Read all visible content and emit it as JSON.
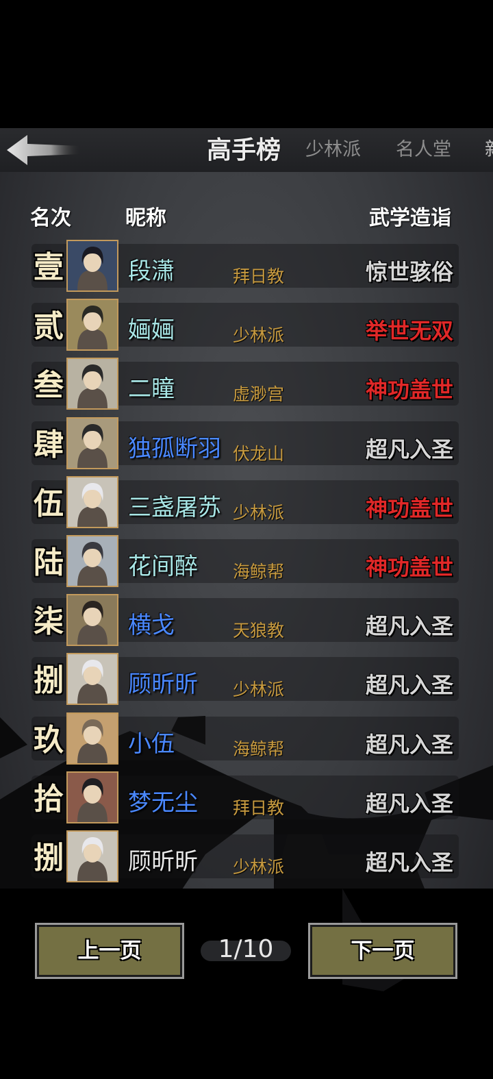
{
  "header": {
    "tabs": [
      {
        "label": "高手榜",
        "active": true
      },
      {
        "label": "少林派",
        "active": false
      },
      {
        "label": "名人堂",
        "active": false
      }
    ]
  },
  "columns": {
    "rank": "名次",
    "nickname": "昵称",
    "skill": "武学造诣"
  },
  "rows": [
    {
      "rank": "壹",
      "name": "段潇",
      "sect": "拜日教",
      "level": "惊世骇俗",
      "name_color": "#a8e6e6",
      "level_color": "#d7d7d7"
    },
    {
      "rank": "贰",
      "name": "婳婳",
      "sect": "少林派",
      "level": "举世无双",
      "name_color": "#a8e6e6",
      "level_color": "#e02828"
    },
    {
      "rank": "叁",
      "name": "二瞳",
      "sect": "虚渺宫",
      "level": "神功盖世",
      "name_color": "#a8e6e6",
      "level_color": "#e02828"
    },
    {
      "rank": "肆",
      "name": "独孤断羽",
      "sect": "伏龙山",
      "level": "超凡入圣",
      "name_color": "#4a88ff",
      "level_color": "#d7d7d7"
    },
    {
      "rank": "伍",
      "name": "三盏屠苏",
      "sect": "少林派",
      "level": "神功盖世",
      "name_color": "#a8e6e6",
      "level_color": "#e02828"
    },
    {
      "rank": "陆",
      "name": "花间醉",
      "sect": "海鲸帮",
      "level": "神功盖世",
      "name_color": "#a8e6e6",
      "level_color": "#e02828"
    },
    {
      "rank": "柒",
      "name": "横戈",
      "sect": "天狼教",
      "level": "超凡入圣",
      "name_color": "#4a88ff",
      "level_color": "#d7d7d7"
    },
    {
      "rank": "捌",
      "name": "顾昕昕",
      "sect": "少林派",
      "level": "超凡入圣",
      "name_color": "#4a88ff",
      "level_color": "#d7d7d7"
    },
    {
      "rank": "玖",
      "name": "小伍",
      "sect": "海鲸帮",
      "level": "超凡入圣",
      "name_color": "#4a88ff",
      "level_color": "#d7d7d7"
    },
    {
      "rank": "拾",
      "name": "梦无尘",
      "sect": "拜日教",
      "level": "超凡入圣",
      "name_color": "#4a88ff",
      "level_color": "#d7d7d7"
    },
    {
      "rank": "捌",
      "name": "顾昕昕",
      "sect": "少林派",
      "level": "超凡入圣",
      "name_color": "#e8e8e8",
      "level_color": "#d7d7d7"
    }
  ],
  "pagination": {
    "prev_label": "上一页",
    "next_label": "下一页",
    "page_text": "1/10"
  }
}
